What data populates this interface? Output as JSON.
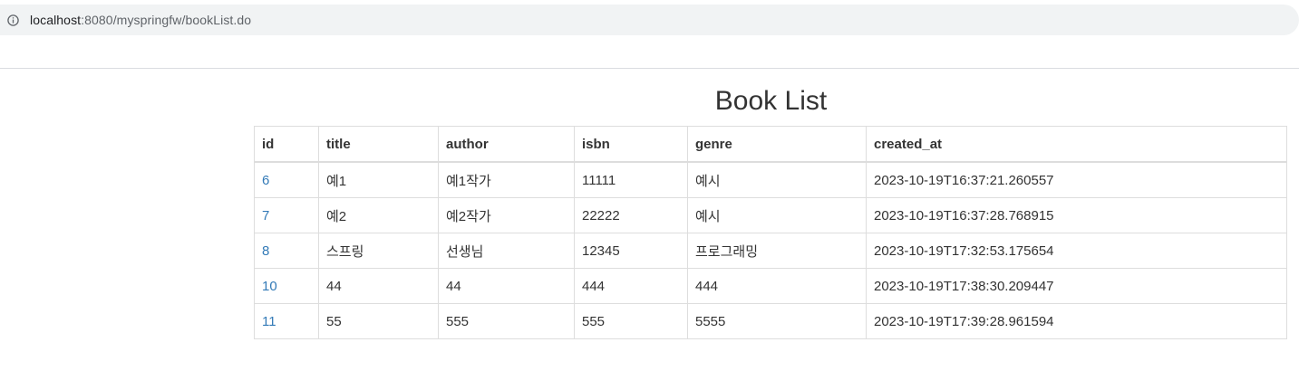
{
  "browser": {
    "url_host": "localhost",
    "url_path": ":8080/myspringfw/bookList.do"
  },
  "page": {
    "title": "Book List"
  },
  "table": {
    "headers": [
      "id",
      "title",
      "author",
      "isbn",
      "genre",
      "created_at"
    ],
    "rows": [
      {
        "id": "6",
        "title": "예1",
        "author": "예1작가",
        "isbn": "11111",
        "genre": "예시",
        "created_at": "2023-10-19T16:37:21.260557"
      },
      {
        "id": "7",
        "title": "예2",
        "author": "예2작가",
        "isbn": "22222",
        "genre": "예시",
        "created_at": "2023-10-19T16:37:28.768915"
      },
      {
        "id": "8",
        "title": "스프링",
        "author": "선생님",
        "isbn": "12345",
        "genre": "프로그래밍",
        "created_at": "2023-10-19T17:32:53.175654"
      },
      {
        "id": "10",
        "title": "44",
        "author": "44",
        "isbn": "444",
        "genre": "444",
        "created_at": "2023-10-19T17:38:30.209447"
      },
      {
        "id": "11",
        "title": "55",
        "author": "555",
        "isbn": "555",
        "genre": "5555",
        "created_at": "2023-10-19T17:39:28.961594"
      }
    ]
  },
  "colors": {
    "link": "#337ab7",
    "address_bar_bg": "#f1f3f4",
    "border": "#dddddd"
  },
  "icons": {
    "address_bar": "info-icon"
  }
}
